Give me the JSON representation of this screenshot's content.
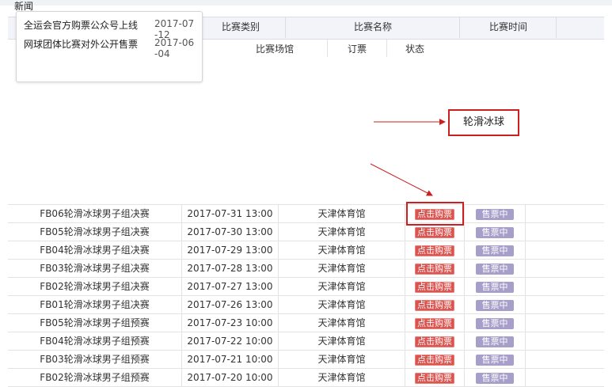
{
  "news": {
    "label": "新闻",
    "items": [
      {
        "title": "全运会官方购票公众号上线",
        "date": "2017-07-12"
      },
      {
        "title": "网球团体比赛对外公开售票",
        "date": "2017-06-04"
      }
    ]
  },
  "table": {
    "headers": {
      "category": "比赛类别",
      "name": "比赛名称",
      "time": "比赛时间"
    },
    "subheaders": {
      "venue": "比赛场馆",
      "booking": "订票",
      "status": "状态"
    },
    "rows": [
      {
        "name": "FB06轮滑冰球男子组决赛",
        "time": "2017-07-31 13:00",
        "venue": "天津体育馆",
        "buy": "点击购票",
        "status": "售票中"
      },
      {
        "name": "FB05轮滑冰球男子组决赛",
        "time": "2017-07-30 13:00",
        "venue": "天津体育馆",
        "buy": "点击购票",
        "status": "售票中"
      },
      {
        "name": "FB04轮滑冰球男子组决赛",
        "time": "2017-07-29 13:00",
        "venue": "天津体育馆",
        "buy": "点击购票",
        "status": "售票中"
      },
      {
        "name": "FB03轮滑冰球男子组决赛",
        "time": "2017-07-28 13:00",
        "venue": "天津体育馆",
        "buy": "点击购票",
        "status": "售票中"
      },
      {
        "name": "FB02轮滑冰球男子组决赛",
        "time": "2017-07-27 13:00",
        "venue": "天津体育馆",
        "buy": "点击购票",
        "status": "售票中"
      },
      {
        "name": "FB01轮滑冰球男子组决赛",
        "time": "2017-07-26 13:00",
        "venue": "天津体育馆",
        "buy": "点击购票",
        "status": "售票中"
      },
      {
        "name": "FB05轮滑冰球男子组预赛",
        "time": "2017-07-23 10:00",
        "venue": "天津体育馆",
        "buy": "点击购票",
        "status": "售票中"
      },
      {
        "name": "FB04轮滑冰球男子组预赛",
        "time": "2017-07-22 10:00",
        "venue": "天津体育馆",
        "buy": "点击购票",
        "status": "售票中"
      },
      {
        "name": "FB03轮滑冰球男子组预赛",
        "time": "2017-07-21 10:00",
        "venue": "天津体育馆",
        "buy": "点击购票",
        "status": "售票中"
      },
      {
        "name": "FB02轮滑冰球男子组预赛",
        "time": "2017-07-20 10:00",
        "venue": "天津体育馆",
        "buy": "点击购票",
        "status": "售票中"
      }
    ]
  },
  "annotation": {
    "callout_label": "轮滑冰球"
  },
  "colors": {
    "buy_button": "#d9534f",
    "status_badge": "#a79ec9",
    "highlight": "#cc1f1f"
  }
}
